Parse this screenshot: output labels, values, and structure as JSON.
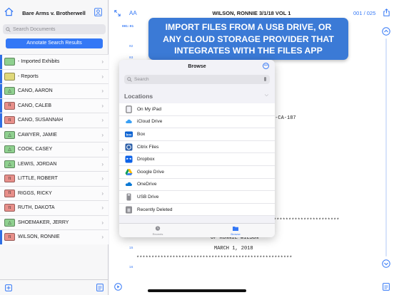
{
  "sidebar": {
    "case_title": "Bare Arms v. Brotherwell",
    "search_placeholder": "Search Documents",
    "annotate_button": "Annotate Search Results",
    "items": [
      {
        "label": "- Imported Exhibits",
        "badge": "",
        "color": "#8fd08f",
        "bar": "#2f6fe4"
      },
      {
        "label": "- Reports",
        "badge": "",
        "color": "#dfd87a",
        "bar": "#2f6fe4"
      },
      {
        "label": "CANO, AARON",
        "badge": "△",
        "color": "#8fd08f",
        "bar": "#2f6fe4"
      },
      {
        "label": "CANO, CALEB",
        "badge": "π",
        "color": "#e88f8a",
        "bar": "#2f6fe4"
      },
      {
        "label": "CANO, SUSANNAH",
        "badge": "π",
        "color": "#e88f8a",
        "bar": "#2f6fe4"
      },
      {
        "label": "CAWYER, JAMIE",
        "badge": "△",
        "color": "#8fd08f",
        "bar": ""
      },
      {
        "label": "COOK, CASEY",
        "badge": "△",
        "color": "#8fd08f",
        "bar": ""
      },
      {
        "label": "LEWIS, JORDAN",
        "badge": "△",
        "color": "#8fd08f",
        "bar": ""
      },
      {
        "label": "LITTLE, ROBERT",
        "badge": "π",
        "color": "#e88f8a",
        "bar": ""
      },
      {
        "label": "RIGGS, RICKY",
        "badge": "π",
        "color": "#e88f8a",
        "bar": ""
      },
      {
        "label": "RUTH, DAKOTA",
        "badge": "π",
        "color": "#e88f8a",
        "bar": ""
      },
      {
        "label": "SHOEMAKER, JERRY",
        "badge": "△",
        "color": "#8fd08f",
        "bar": ""
      },
      {
        "label": "WILSON, RONNIE",
        "badge": "π",
        "color": "#e88f8a",
        "bar": "#2f6fe4"
      }
    ]
  },
  "document": {
    "title": "WILSON, RONNIE 3/1/18 VOL 1",
    "page_indicator": "001 / 025",
    "text_size_label": "AA",
    "first_line_no": "001:01",
    "line_numbers": [
      "02",
      "03",
      "04",
      "05",
      "06",
      "07",
      "08",
      "09",
      "10",
      "11",
      "12",
      "13",
      "14",
      "15",
      "16"
    ],
    "case_no_fragment": "7-CA-187",
    "stars_right": "**********************",
    "deposition_of": "OF RONNIE WILSON",
    "date": "MARCH 1, 2018",
    "stars_full": "****************************************************"
  },
  "banner": {
    "line1": "IMPORT FILES FROM A USB DRIVE, OR",
    "line2": "ANY CLOUD STORAGE PROVIDER THAT",
    "line3": "INTEGRATES WITH THE FILES APP"
  },
  "browse": {
    "title": "Browse",
    "search_placeholder": "Search",
    "locations_header": "Locations",
    "locations": [
      {
        "label": "On My iPad",
        "icon": "ipad-icon"
      },
      {
        "label": "iCloud Drive",
        "icon": "icloud-icon"
      },
      {
        "label": "Box",
        "icon": "box-icon"
      },
      {
        "label": "Citrix Files",
        "icon": "citrix-icon"
      },
      {
        "label": "Dropbox",
        "icon": "dropbox-icon"
      },
      {
        "label": "Google Drive",
        "icon": "google-drive-icon"
      },
      {
        "label": "OneDrive",
        "icon": "onedrive-icon"
      },
      {
        "label": "USB Drive",
        "icon": "usb-drive-icon"
      },
      {
        "label": "Recently Deleted",
        "icon": "trash-icon"
      }
    ],
    "tabs": {
      "recents": "Recents",
      "browse": "Browse"
    }
  },
  "colors": {
    "accent": "#3478f6",
    "banner": "#3b7ad6"
  }
}
